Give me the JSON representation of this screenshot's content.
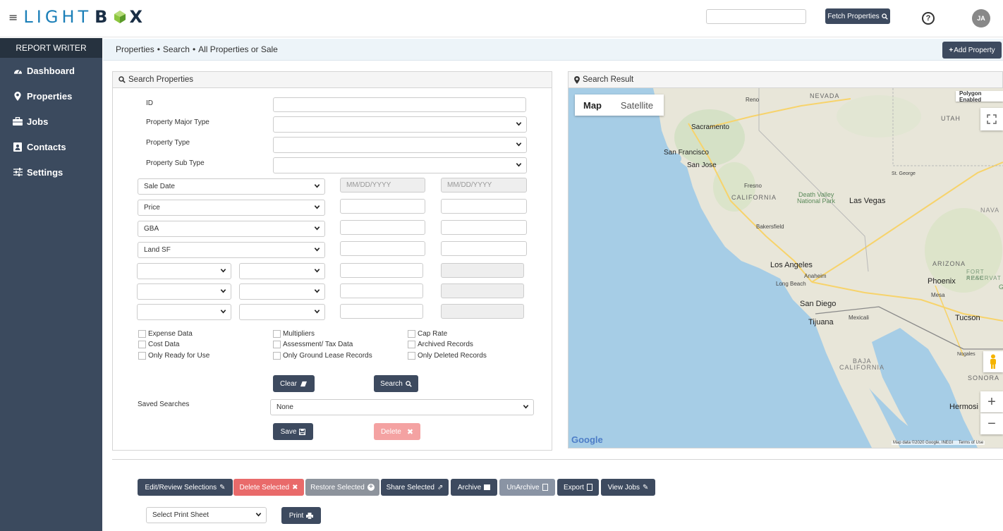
{
  "brand": {
    "light": "LIGHT",
    "b": "B",
    "x": "X"
  },
  "header": {
    "search_placeholder": "",
    "fetch_label": "Fetch Properties",
    "help_label": "?",
    "avatar_initials": "JA"
  },
  "sidebar": {
    "title": "REPORT WRITER",
    "items": [
      {
        "label": "Dashboard",
        "icon": "dashboard-icon"
      },
      {
        "label": "Properties",
        "icon": "map-marker-icon"
      },
      {
        "label": "Jobs",
        "icon": "briefcase-icon"
      },
      {
        "label": "Contacts",
        "icon": "contacts-icon"
      },
      {
        "label": "Settings",
        "icon": "sliders-icon"
      }
    ]
  },
  "breadcrumb": {
    "a": "Properties",
    "b": "Search",
    "c": "All Properties or Sale",
    "sep": "•"
  },
  "add_property_label": "Add Property",
  "search_panel": {
    "title": "Search Properties",
    "fields": {
      "id": "ID",
      "major_type": "Property Major Type",
      "type": "Property Type",
      "sub_type": "Property Sub Type"
    },
    "filters": [
      {
        "select": "Sale Date",
        "from_placeholder": "MM/DD/YYYY",
        "to_placeholder": "MM/DD/YYYY"
      },
      {
        "select": "Price"
      },
      {
        "select": "GBA"
      },
      {
        "select": "Land SF"
      }
    ],
    "checkboxes": [
      "Expense Data",
      "Cost Data",
      "Only Ready for Use",
      "Multipliers",
      "Assessment/ Tax Data",
      "Only Ground Lease Records",
      "Cap Rate",
      "Archived Records",
      "Only Deleted Records"
    ],
    "clear_label": "Clear",
    "search_label": "Search",
    "saved_searches_label": "Saved Searches",
    "saved_searches_value": "None",
    "save_label": "Save",
    "delete_label": "Delete"
  },
  "result_panel": {
    "title": "Search Result",
    "map_tab": "Map",
    "satellite_tab": "Satellite",
    "polygon_label": "Polygon Enabled",
    "google_label": "Google",
    "map_data": "Map data ©2020 Google, INEGI",
    "terms": "Terms of Use",
    "places": {
      "nevada": "NEVADA",
      "reno": "Reno",
      "utah": "UTAH",
      "sacramento": "Sacramento",
      "sf": "San Francisco",
      "sj": "San Jose",
      "stgeorge": "St. George",
      "fresno": "Fresno",
      "california": "CALIFORNIA",
      "dv1": "Death Valley",
      "dv2": "National Park",
      "lv": "Las Vegas",
      "nava": "NAVA",
      "bakersfield": "Bakersfield",
      "la": "Los Angeles",
      "anaheim": "Anaheim",
      "lb": "Long Beach",
      "arizona": "ARIZONA",
      "fortapache": "FORT APAC",
      "reservat": "RESERVAT",
      "phoenix": "Phoenix",
      "mesa": "Mesa",
      "sd": "San Diego",
      "tijuana": "Tijuana",
      "mexicali": "Mexicali",
      "tucson": "Tucson",
      "nogales": "Nogales",
      "baja1": "BAJA",
      "baja2": "CALIFORNIA",
      "sonora": "SONORA",
      "hermosillo": "Hermosi",
      "g": "G"
    }
  },
  "actions": {
    "edit": "Edit/Review Selections",
    "delete": "Delete Selected",
    "restore": "Restore Selected",
    "share": "Share Selected",
    "archive": "Archive",
    "unarchive": "UnArchive",
    "export": "Export",
    "view_jobs": "View Jobs",
    "print_sheet": "Select Print Sheet",
    "print": "Print"
  },
  "colors": {
    "brand_blue": "#1b7fb8",
    "sidebar": "#3b4a5e",
    "dark_button": "#3d4a5f",
    "danger": "#e96a6a"
  }
}
